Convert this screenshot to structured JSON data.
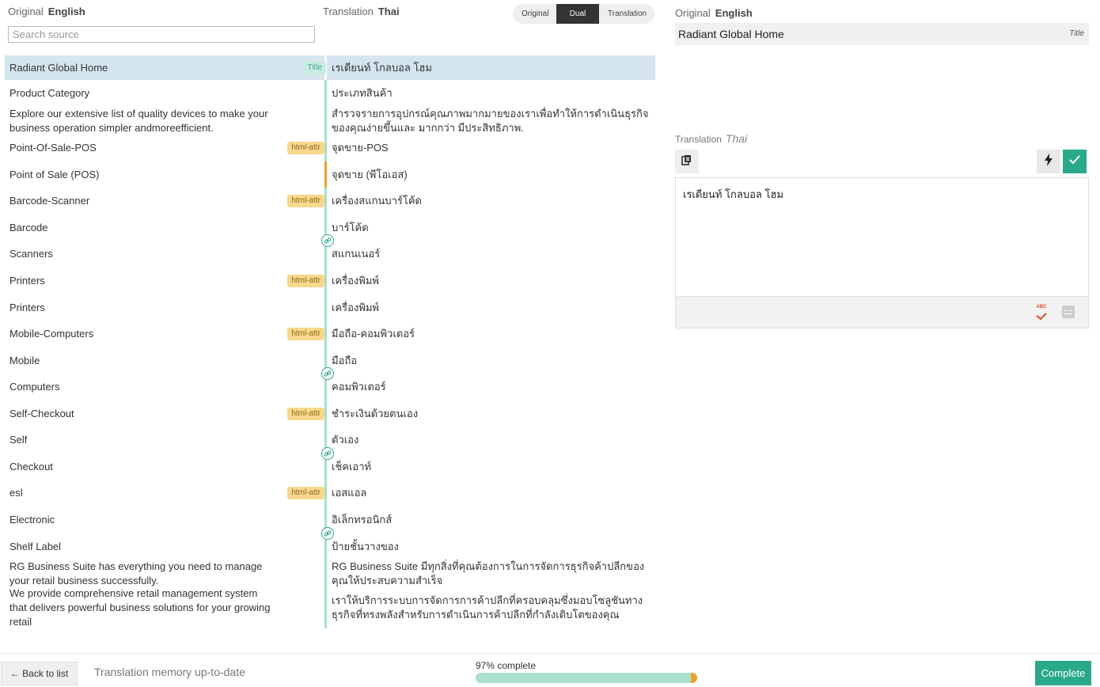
{
  "left_panel": {
    "original_label": "Original",
    "original_lang": "English",
    "translation_label": "Translation",
    "translation_lang": "Thai",
    "search_placeholder": "Search source",
    "view_modes": [
      "Original",
      "Dual",
      "Translation"
    ],
    "active_view_mode": "Dual"
  },
  "rows": [
    {
      "source": "Radiant Global Home",
      "target": "เรเดียนท์ โกลบอล โฮม",
      "tag": "Title",
      "selected": true
    },
    {
      "source": "Product Category",
      "target": "ประเภทสินค้า"
    },
    {
      "source": "Explore our extensive list of quality devices to make your business operation simpler andmoreefficient.",
      "target": "สำรวจรายการอุปกรณ์คุณภาพมากมายของเราเพื่อทำให้การดำเนินธุรกิจของคุณง่ายขึ้นและ มากกว่า มีประสิทธิภาพ."
    },
    {
      "source": "Point-Of-Sale-POS",
      "target": "จุดขาย-POS",
      "tag": "html-attr"
    },
    {
      "source": "Point of Sale (POS)",
      "target": "จุดขาย (พีโอเอส)",
      "status": "orange"
    },
    {
      "source": "Barcode-Scanner",
      "target": "เครื่องสแกนบาร์โค้ด",
      "tag": "html-attr"
    },
    {
      "source": "Barcode",
      "target": "บาร์โค้ด"
    },
    {
      "source": "Scanners",
      "target": "สแกนเนอร์"
    },
    {
      "source": "Printers",
      "target": "เครื่องพิมพ์",
      "tag": "html-attr"
    },
    {
      "source": "Printers",
      "target": "เครื่องพิมพ์"
    },
    {
      "source": "Mobile-Computers",
      "target": "มือถือ-คอมพิวเตอร์",
      "tag": "html-attr"
    },
    {
      "source": "Mobile",
      "target": "มือถือ"
    },
    {
      "source": "Computers",
      "target": "คอมพิวเตอร์"
    },
    {
      "source": "Self-Checkout",
      "target": "ชำระเงินด้วยตนเอง",
      "tag": "html-attr"
    },
    {
      "source": "Self",
      "target": "ตัวเอง"
    },
    {
      "source": "Checkout",
      "target": "เช็คเอาท์"
    },
    {
      "source": "esl",
      "target": "เอสแอล",
      "tag": "html-attr"
    },
    {
      "source": "Electronic",
      "target": "อิเล็กทรอนิกส์"
    },
    {
      "source": "Shelf Label",
      "target": "ป้ายชั้นวางของ"
    },
    {
      "source": "RG Business Suite has everything you need to manage your retail business successfully.",
      "target": "RG Business Suite มีทุกสิ่งที่คุณต้องการในการจัดการธุรกิจค้าปลีกของคุณให้ประสบความสำเร็จ"
    },
    {
      "source": "We provide comprehensive retail management system that delivers powerful business solutions for your growing retail",
      "target": "เราให้บริการระบบการจัดการการค้าปลีกที่ครอบคลุมซึ่งมอบโซลูชันทางธุรกิจที่ทรงพลังสำหรับการดำเนินการค้าปลีกที่กำลังเติบโตของคุณ"
    }
  ],
  "right_panel": {
    "original_label": "Original",
    "original_lang": "English",
    "source_text": "Radiant Global Home",
    "source_type": "Title",
    "translation_label": "Translation",
    "translation_lang": "Thai",
    "translation_text": "เรเดียนท์ โกลบอล โฮม",
    "spellcheck_label": "ABC"
  },
  "footer": {
    "back_label": "← Back to list",
    "tm_status": "Translation memory up-to-date",
    "progress_text": "97% complete",
    "progress_fraction": 0.97,
    "complete_label": "Complete"
  },
  "colors": {
    "accent": "#2aa88a",
    "selected_row": "#d5e5ef",
    "tag_html_attr": "#f7d88c",
    "status_bar": "#a9e0ce",
    "warning": "#f0a030"
  }
}
